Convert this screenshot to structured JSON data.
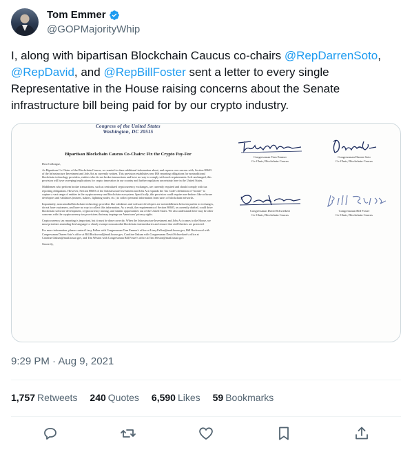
{
  "author": {
    "name": "Tom Emmer",
    "handle": "@GOPMajorityWhip",
    "verified_color": "#1d9bf0"
  },
  "tweet": {
    "segments": [
      "I, along with bipartisan Blockchain Caucus co-chairs ",
      "@RepDarrenSoto",
      ", ",
      "@RepDavid",
      ", and ",
      "@RepBillFoster",
      " sent a letter to every single Representative in the House raising concerns about the Senate infrastructure bill being paid for by our crypto industry."
    ],
    "mention_color": "#1d9bf0"
  },
  "letter": {
    "letterhead_1": "Congress of the United States",
    "letterhead_2": "Washington, DC 20515",
    "title": "Bipartisan Blockchain Caucus Co-Chairs: Fix the Crypto Pay-For",
    "greeting": "Dear Colleague,",
    "p1": "As Bipartisan Co-Chairs of the Blockchain Caucus, we wanted to share additional information about, and express our concern with, Section 80603 of the Infrastructure Investment and Jobs Act as currently written. This provision establishes new IRS reporting obligations for nontraditional blockchain technology providers, entities who do not broker transactions and have no way to comply with such requirements. Left unchanged, this provision will have sweeping implications for crypto innovation in our country and further regulatory uncertainty here in the United States.",
    "p2": "Middlemen who perform broker transactions, such as centralized cryptocurrency exchanges, are currently required and should comply with tax reporting obligations. However, Section 80603 of the Infrastructure Investment and Jobs Act expands the Tax Code's definition of \"broker\" to capture a vast range of entities in the cryptocurrency and blockchain ecosystem. Specifically, this provision could require non-brokers like software developers and validators (miners, stakers, lightning nodes, etc.) to collect personal information from users of blockchain networks.",
    "p3": "Importantly, noncustodial blockchain technology providers like validators and software developers are not middlemen between parties to exchanges, do not have customers, and have no way to collect this information. As a result, the requirements of Section 80603, as currently drafted, could drive blockchain software development, cryptocurrency mining, and similar opportunities out of the United States. We also understand there may be other concerns with the cryptocurrency tax provisions that may impinge on Americans' privacy rights.",
    "p4": "Cryptocurrency tax reporting is important, but it must be done correctly. When the Infrastructure Investment and Jobs Act comes to the House, we must prioritize amending this language to clearly exempt noncustodial blockchain intermediaries and ensure that civil liberties are protected.",
    "p5_text": "For more information, please contact Lizzy Fallon with Congressman Tom Emmer's office at Lizzy.Fallon@mail.house.gov, Bill Rockwood with Congressman Darren Soto's office at Bill.Rockwood@mail.house.gov, Caroline Oakum with Congressman David Schweikert's office at Caroline.Oakum@mail.house.gov, and Tim Weston with Congressman Bill Foster's office at Tim.Weston@mail.house.gov.",
    "closing": "Sincerely,",
    "signatures": [
      {
        "scrawl": "Tom Emmer",
        "line1": "Congressman Tom Emmer",
        "line2": "Co-Chair, Blockchain Caucus"
      },
      {
        "scrawl": "Darren Soto",
        "line1": "Congressman Darren Soto",
        "line2": "Co-Chair, Blockchain Caucus"
      },
      {
        "scrawl": "David Schweikert",
        "line1": "Congressman David Schweikert",
        "line2": "Co-Chair, Blockchain Caucus"
      },
      {
        "scrawl": "Bill Foster",
        "line1": "Congressman Bill Foster",
        "line2": "Co-Chair, Blockchain Caucus"
      }
    ]
  },
  "timestamp": "9:29 PM · Aug 9, 2021",
  "stats": [
    {
      "num": "1,757",
      "label": "Retweets"
    },
    {
      "num": "240",
      "label": "Quotes"
    },
    {
      "num": "6,590",
      "label": "Likes"
    },
    {
      "num": "59",
      "label": "Bookmarks"
    }
  ],
  "actions": [
    "reply-icon",
    "retweet-icon",
    "like-icon",
    "bookmark-icon",
    "share-icon"
  ],
  "icon_color": "#536471"
}
